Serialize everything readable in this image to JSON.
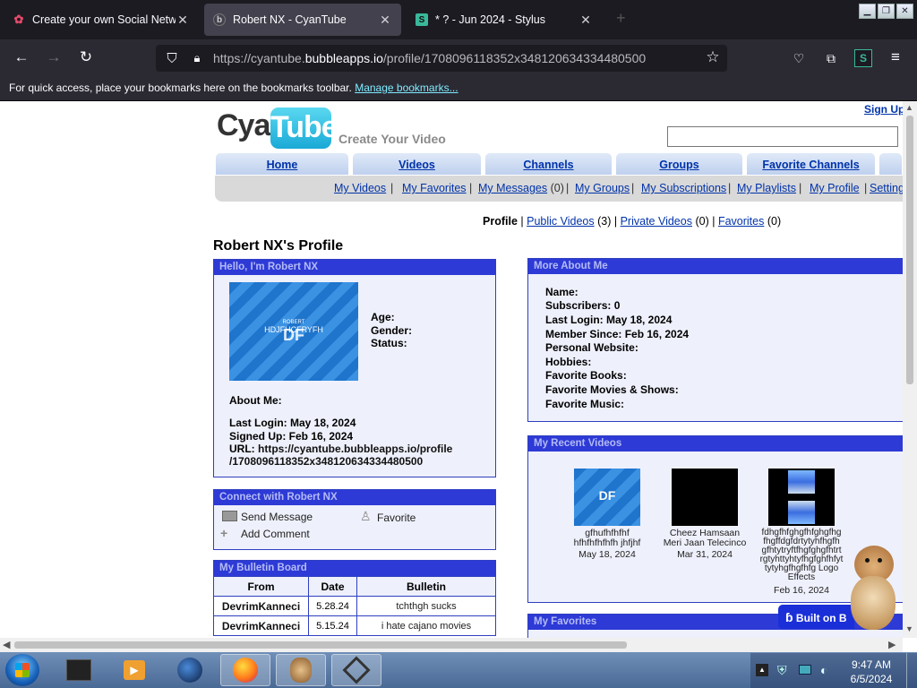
{
  "browser": {
    "tabs": [
      {
        "label": "Create your own Social Netwo",
        "icon": "bubble"
      },
      {
        "label": "Robert NX - CyanTube",
        "icon": "b"
      },
      {
        "label": "* ? - Jun 2024 - Stylus",
        "icon": "S"
      }
    ],
    "close_glyph": "✕",
    "new_tab_glyph": "+",
    "url_prefix": "https://cyantube.",
    "url_domain": "bubbleapps.io",
    "url_rest": "/profile/1708096118352x348120634334480500",
    "bookmarks_text": "For quick access, place your bookmarks here on the bookmarks toolbar.",
    "bookmarks_link": "Manage bookmarks..."
  },
  "site": {
    "logo_left": "Cyan",
    "logo_right": "Tube",
    "tagline": "Create Your Video",
    "signup": "Sign Up",
    "nav_tabs": [
      "Home",
      "Videos",
      "Channels",
      "Groups",
      "Favorite Channels"
    ],
    "subnav": [
      {
        "label": "My Videos"
      },
      {
        "label": "My Favorites"
      },
      {
        "label": "My Messages",
        "count": "(0)"
      },
      {
        "label": "My Groups"
      },
      {
        "label": "My Subscriptions"
      },
      {
        "label": "My Playlists"
      },
      {
        "label": "My Profile"
      },
      {
        "label": "Settings"
      }
    ],
    "separator": "|"
  },
  "profile_nav": {
    "current": "Profile",
    "public_videos": "Public Videos",
    "public_count": "(3)",
    "private_videos": "Private Videos",
    "private_count": "(0)",
    "favorites": "Favorites",
    "favorites_count": "(0)"
  },
  "profile": {
    "title": "Robert NX's Profile",
    "hello_header": "Hello, I'm Robert NX",
    "avatar_small": "ROBERT",
    "avatar_text": "HDJFHCFRYFH",
    "avatar_big": "DF",
    "age_label": "Age:",
    "gender_label": "Gender:",
    "status_label": "Status:",
    "about_label": "About Me:",
    "last_login": "Last Login: May 18, 2024",
    "signed_up": "Signed Up: Feb 16, 2024",
    "url_label": "URL:",
    "url_line1": "https://cyantube.bubbleapps.io/profile",
    "url_line2": "/1708096118352x348120634334480500"
  },
  "connect": {
    "header": "Connect with Robert NX",
    "send_message": "Send Message",
    "favorite": "Favorite",
    "add_comment": "Add Comment"
  },
  "bulletin": {
    "header": "My Bulletin Board",
    "columns": [
      "From",
      "Date",
      "Bulletin"
    ],
    "rows": [
      {
        "from": "DevrimKanneci",
        "date": "5.28.24",
        "bulletin": "tchthgh sucks"
      },
      {
        "from": "DevrimKanneci",
        "date": "5.15.24",
        "bulletin": "i hate cajano movies"
      }
    ]
  },
  "more_about": {
    "header": "More About Me",
    "lines": [
      "Name:",
      "Subscribers: 0",
      "Last Login: May 18, 2024",
      "Member Since: Feb 16, 2024",
      "Personal Website:",
      "Hobbies:",
      "Favorite Books:",
      "Favorite Movies & Shows:",
      "Favorite Music:"
    ]
  },
  "recent_videos": {
    "header": "My Recent Videos",
    "videos": [
      {
        "title1": "gfhufhfhfhf",
        "title2": "hfhfhfhfhfh jhfjhf",
        "date": "May 18, 2024",
        "thumb_text": "DF"
      },
      {
        "title1": "Cheez Hamsaan",
        "title2": "Meri Jaan Telecinco",
        "date": "Mar 31, 2024"
      },
      {
        "title1": "fdhgfhfghgfhfghgfhg",
        "title2": "fhgffdgfdrtytyhfhgfh",
        "title3": "gfhtytryftfhgfghgfhtrt",
        "title4": "rgtyhttyhtyfhgfghfhfyt",
        "title5": "tytyhgfhgfhfg Logo",
        "title6": "Effects",
        "date": "Feb 16, 2024"
      }
    ]
  },
  "favorites_header": "My Favorites",
  "built_badge": "Built on B",
  "taskbar": {
    "time": "9:47 AM",
    "date": "6/5/2024"
  }
}
